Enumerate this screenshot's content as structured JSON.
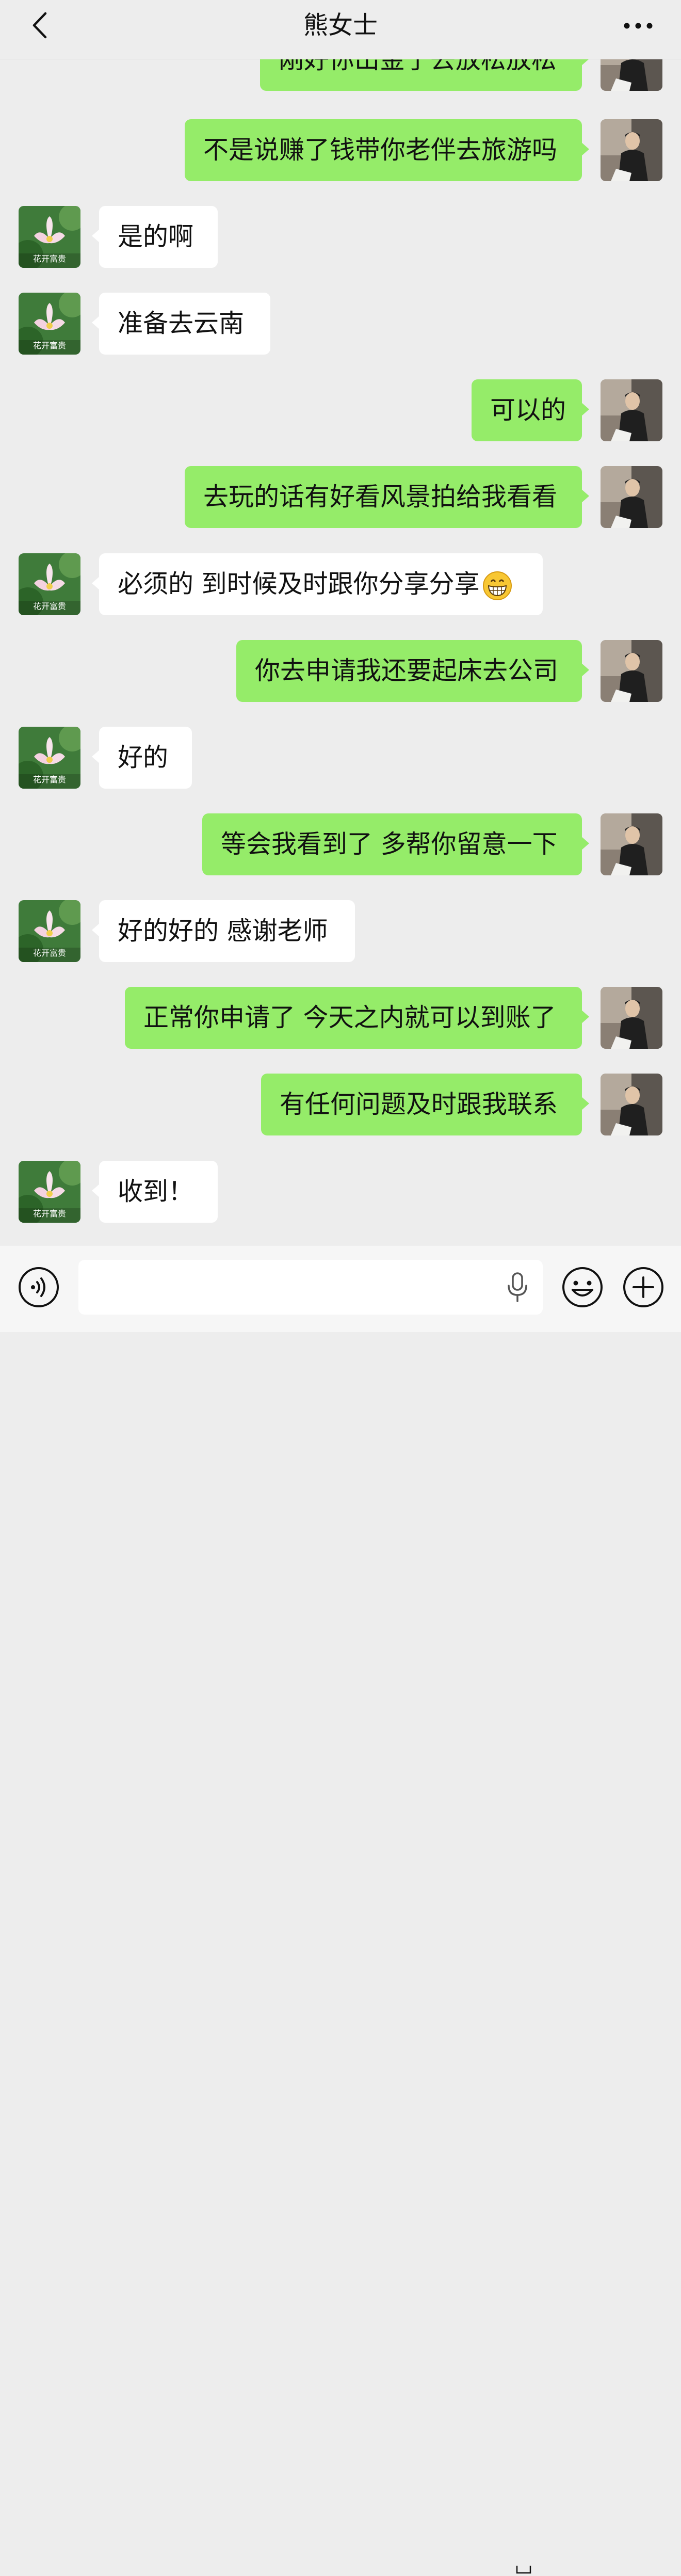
{
  "header": {
    "title": "熊女士",
    "back_icon": "chevron-left-icon",
    "more_icon": "more-dots-icon"
  },
  "contact_avatar_caption": "花开富贵",
  "messages": [
    {
      "side": "right",
      "text": "刚好你出金了去放松放松"
    },
    {
      "side": "right",
      "text": "不是说赚了钱带你老伴去旅游吗"
    },
    {
      "side": "left",
      "text": "是的啊"
    },
    {
      "side": "left",
      "text": "准备去云南"
    },
    {
      "side": "right",
      "text": "可以的"
    },
    {
      "side": "right",
      "text": "去玩的话有好看风景拍给我看看"
    },
    {
      "side": "left",
      "text": "必须的 到时候及时跟你分享分享",
      "emoji": "grinning-face-icon"
    },
    {
      "side": "right",
      "text": "你去申请我还要起床去公司"
    },
    {
      "side": "left",
      "text": "好的"
    },
    {
      "side": "right",
      "text": "等会我看到了 多帮你留意一下"
    },
    {
      "side": "left",
      "text": "好的好的 感谢老师"
    },
    {
      "side": "right",
      "text": "正常你申请了 今天之内就可以到账了"
    },
    {
      "side": "right",
      "text": "有任何问题及时跟我联系"
    },
    {
      "side": "left",
      "text": "收到！"
    }
  ],
  "input_bar": {
    "text_value": "",
    "voice_icon": "voice-icon",
    "mic_icon": "microphone-icon",
    "emoji_icon": "emoji-icon",
    "plus_icon": "plus-icon"
  },
  "colors": {
    "background": "#ededed",
    "sent_bubble": "#95ec69",
    "received_bubble": "#ffffff"
  }
}
